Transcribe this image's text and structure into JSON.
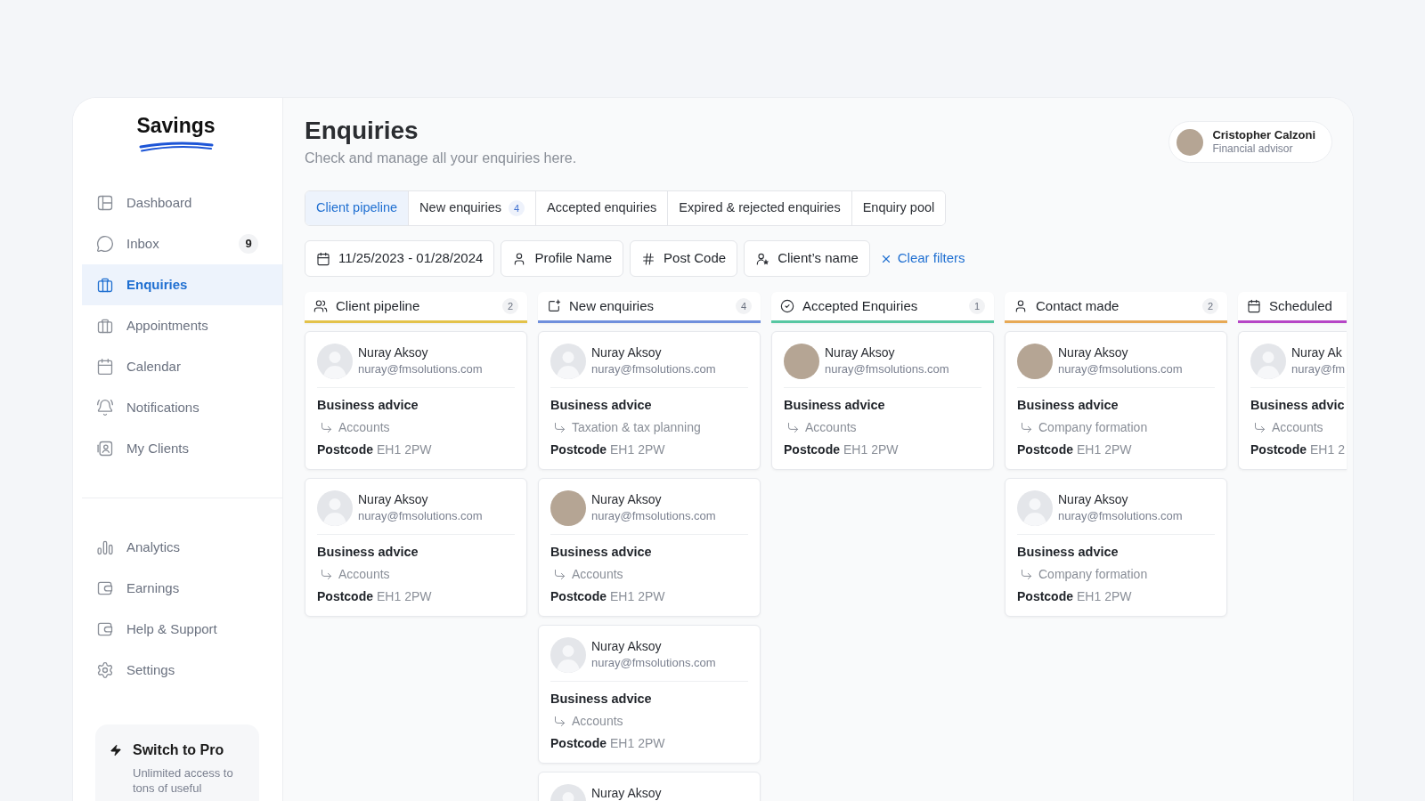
{
  "sidebar": {
    "logo": "Savings",
    "nav": [
      {
        "label": "Dashboard",
        "selected": false
      },
      {
        "label": "Inbox",
        "selected": false,
        "badge": "9"
      },
      {
        "label": "Enquiries",
        "selected": true
      },
      {
        "label": "Appointments",
        "selected": false
      },
      {
        "label": "Calendar",
        "selected": false
      },
      {
        "label": "Notifications",
        "selected": false
      },
      {
        "label": "My Clients",
        "selected": false
      }
    ],
    "nav_secondary": [
      {
        "label": "Analytics",
        "selected": false
      },
      {
        "label": "Earnings",
        "selected": false
      },
      {
        "label": "Help & Support",
        "selected": false
      },
      {
        "label": "Settings",
        "selected": false
      }
    ],
    "promo": {
      "title": "Switch to Pro",
      "text": "Unlimited access to tons of useful"
    }
  },
  "header": {
    "title": "Enquiries",
    "subtitle": "Check and manage all your enquiries here.",
    "user": {
      "name": "Cristopher Calzoni",
      "role": "Financial advisor"
    }
  },
  "tabs": [
    {
      "label": "Client pipeline",
      "selected": true
    },
    {
      "label": "New enquiries",
      "badge": "4",
      "selected": false
    },
    {
      "label": "Accepted enquiries",
      "selected": false
    },
    {
      "label": "Expired & rejected enquiries",
      "selected": false
    },
    {
      "label": "Enquiry pool",
      "selected": false
    }
  ],
  "filters": [
    {
      "label": "11/25/2023 - 01/28/2024"
    },
    {
      "label": "Profile Name"
    },
    {
      "label": "Post Code"
    },
    {
      "label": "Client’s name"
    }
  ],
  "clear_filters": "Clear filters",
  "columns": [
    {
      "title": "Client pipeline",
      "count": "2",
      "color": "#e3c24a",
      "cards": [
        {
          "avatar": {
            "kind": "placeholder"
          },
          "name": "Nuray Aksoy",
          "email": "nuray@fmsolutions.com",
          "category": "Business advice",
          "subcategory": "Accounts",
          "postcode_label": "Postcode",
          "postcode": "EH1 2PW"
        },
        {
          "avatar": {
            "kind": "placeholder"
          },
          "name": "Nuray Aksoy",
          "email": "nuray@fmsolutions.com",
          "category": "Business advice",
          "subcategory": "Accounts",
          "postcode_label": "Postcode",
          "postcode": "EH1 2PW"
        }
      ]
    },
    {
      "title": "New enquiries",
      "count": "4",
      "color": "#6f8fdc",
      "cards": [
        {
          "avatar": {
            "kind": "placeholder"
          },
          "name": "Nuray Aksoy",
          "email": "nuray@fmsolutions.com",
          "category": "Business advice",
          "subcategory": "Taxation & tax planning",
          "postcode_label": "Postcode",
          "postcode": "EH1 2PW"
        },
        {
          "avatar": {
            "kind": "photo"
          },
          "name": "Nuray Aksoy",
          "email": "nuray@fmsolutions.com",
          "category": "Business advice",
          "subcategory": "Accounts",
          "postcode_label": "Postcode",
          "postcode": "EH1 2PW"
        },
        {
          "avatar": {
            "kind": "placeholder"
          },
          "name": "Nuray Aksoy",
          "email": "nuray@fmsolutions.com",
          "category": "Business advice",
          "subcategory": "Accounts",
          "postcode_label": "Postcode",
          "postcode": "EH1 2PW"
        },
        {
          "avatar": {
            "kind": "placeholder"
          },
          "name": "Nuray Aksoy"
        }
      ]
    },
    {
      "title": "Accepted Enquiries",
      "count": "1",
      "color": "#57c7a2",
      "cards": [
        {
          "avatar": {
            "kind": "photo"
          },
          "name": "Nuray Aksoy",
          "email": "nuray@fmsolutions.com",
          "category": "Business advice",
          "subcategory": "Accounts",
          "postcode_label": "Postcode",
          "postcode": "EH1 2PW"
        }
      ]
    },
    {
      "title": "Contact made",
      "count": "2",
      "color": "#e7a955",
      "cards": [
        {
          "avatar": {
            "kind": "photo"
          },
          "name": "Nuray Aksoy",
          "email": "nuray@fmsolutions.com",
          "category": "Business advice",
          "subcategory": "Company formation",
          "postcode_label": "Postcode",
          "postcode": "EH1 2PW"
        },
        {
          "avatar": {
            "kind": "placeholder"
          },
          "name": "Nuray Aksoy",
          "email": "nuray@fmsolutions.com",
          "category": "Business advice",
          "subcategory": "Company formation",
          "postcode_label": "Postcode",
          "postcode": "EH1 2PW"
        }
      ]
    },
    {
      "title": "Scheduled",
      "color": "#b646c6",
      "cards": [
        {
          "avatar": {
            "kind": "placeholder"
          },
          "name": "Nuray Ak",
          "email": "nuray@fm",
          "category": "Business advic",
          "subcategory": "Accounts",
          "postcode_label": "Postcode",
          "postcode": "EH1 2"
        }
      ]
    }
  ]
}
